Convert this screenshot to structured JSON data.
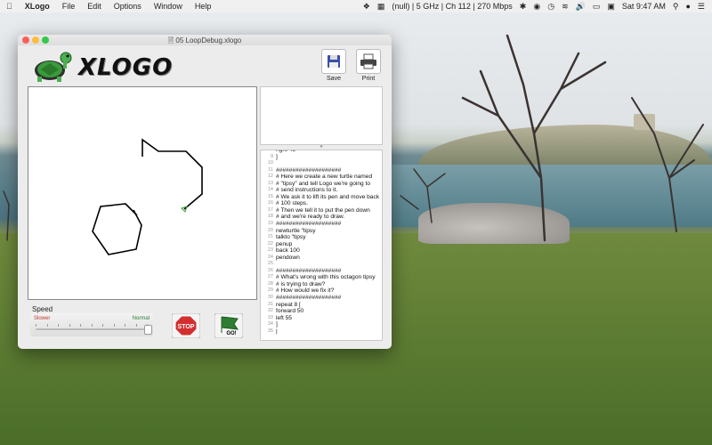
{
  "menubar": {
    "app_name": "XLogo",
    "items": [
      "File",
      "Edit",
      "Options",
      "Window",
      "Help"
    ],
    "wifi_status": "(null) | 5 GHz | Ch 112 | 270 Mbps",
    "clock": "Sat 9:47 AM"
  },
  "window": {
    "title": "05 LoopDebug.xlogo",
    "logo_text": "XLOGO",
    "toolbar": {
      "save_label": "Save",
      "print_label": "Print"
    },
    "speed": {
      "label": "Speed",
      "slow_label": "Slower",
      "fast_label": "Normal",
      "value_fraction": 1.0
    },
    "buttons": {
      "stop_label": "STOP",
      "go_label": "GO!"
    },
    "editor": {
      "lines": [
        {
          "n": "8",
          "text": "right 45"
        },
        {
          "n": "9",
          "text": "]"
        },
        {
          "n": "10",
          "text": ""
        },
        {
          "n": "11",
          "text": "####################"
        },
        {
          "n": "12",
          "text": "# Here we create a new turtle named"
        },
        {
          "n": "13",
          "text": "# \"tipsy\" and tell Logo we're going to"
        },
        {
          "n": "14",
          "text": "# send instructions to it."
        },
        {
          "n": "15",
          "text": "# We ask it to lift its pen and move back"
        },
        {
          "n": "16",
          "text": "# 100 steps."
        },
        {
          "n": "17",
          "text": "# Then we tell it to put the pen down"
        },
        {
          "n": "18",
          "text": "# and we're ready to draw."
        },
        {
          "n": "19",
          "text": "####################"
        },
        {
          "n": "20",
          "text": "newturtle \"tipsy"
        },
        {
          "n": "21",
          "text": "talkto \"tipsy"
        },
        {
          "n": "22",
          "text": "penup"
        },
        {
          "n": "23",
          "text": "back 100"
        },
        {
          "n": "24",
          "text": "pendown"
        },
        {
          "n": "25",
          "text": ""
        },
        {
          "n": "26",
          "text": "####################"
        },
        {
          "n": "27",
          "text": "# What's wrong with this octagon tipsy"
        },
        {
          "n": "28",
          "text": "# is trying to draw?"
        },
        {
          "n": "29",
          "text": "# How would we fix it?"
        },
        {
          "n": "30",
          "text": "####################"
        },
        {
          "n": "31",
          "text": "repeat 8 ["
        },
        {
          "n": "32",
          "text": "  forward 50"
        },
        {
          "n": "33",
          "text": "  left 55"
        },
        {
          "n": "34",
          "text": "]"
        },
        {
          "n": "35",
          "text": "|"
        }
      ]
    }
  },
  "colors": {
    "stop": "#d32f2f",
    "go": "#2e7d32",
    "turtle_green": "#3a9b3a"
  }
}
